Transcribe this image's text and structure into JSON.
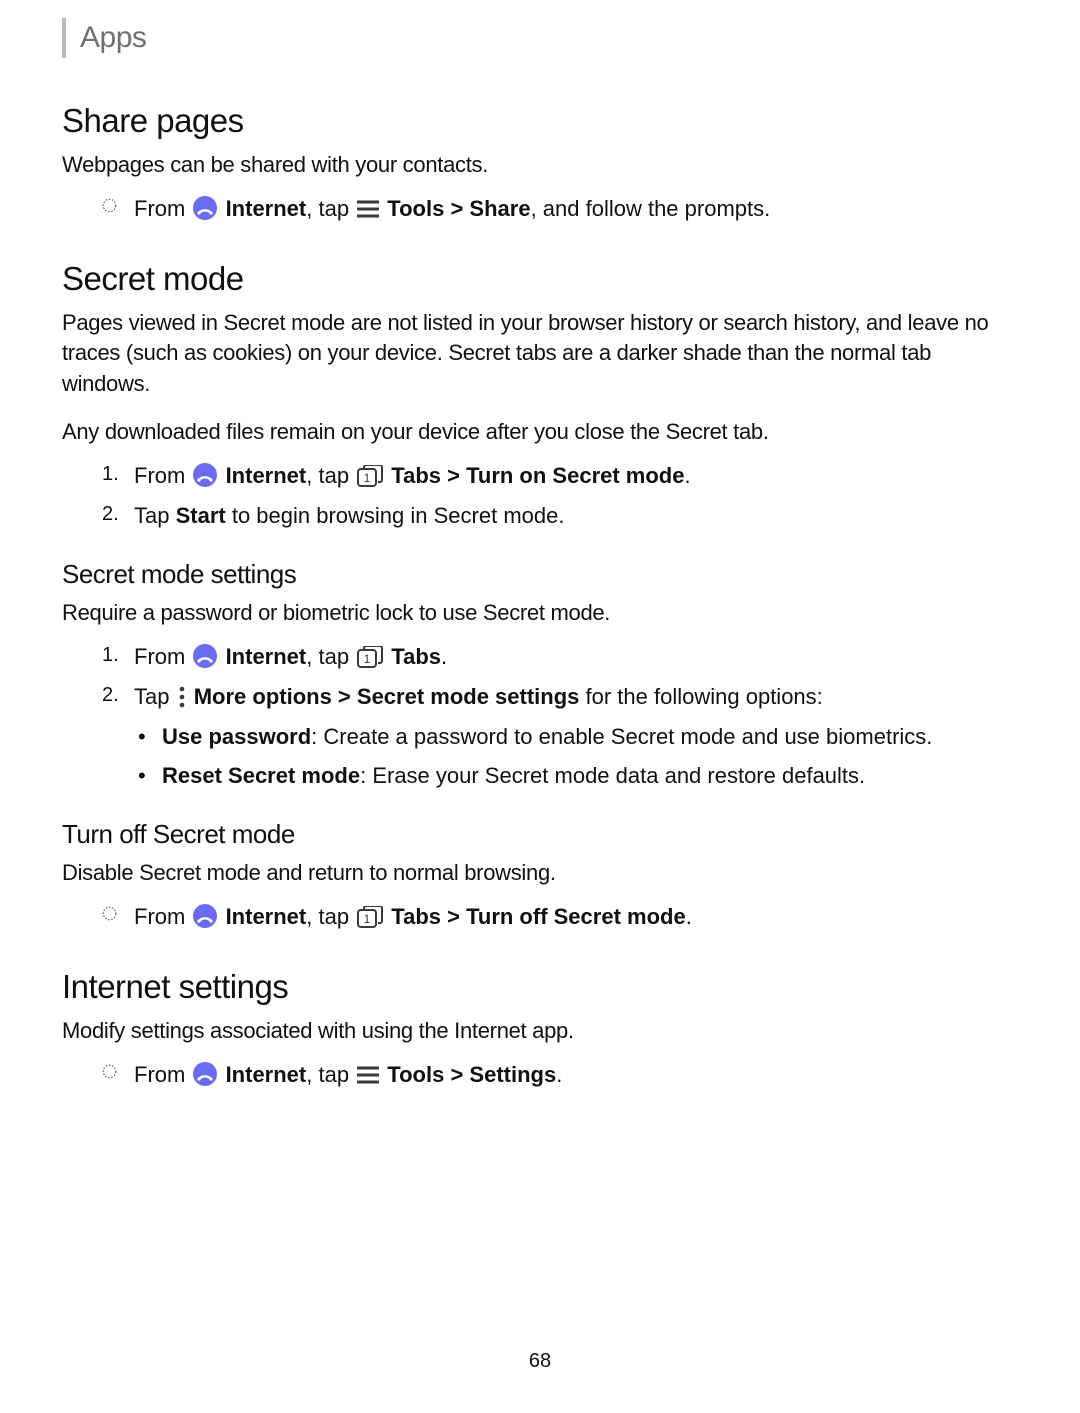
{
  "header": {
    "label": "Apps"
  },
  "sections": {
    "share": {
      "title": "Share pages",
      "desc": "Webpages can be shared with your contacts.",
      "step_prefix": "From ",
      "internet": " Internet",
      "step_mid1": ", tap ",
      "tools": " Tools",
      "sep": " > ",
      "share": "Share",
      "step_suffix": ", and follow the prompts."
    },
    "secret": {
      "title": "Secret mode",
      "desc1": "Pages viewed in Secret mode are not listed in your browser history or search history, and leave no traces (such as cookies) on your device. Secret tabs are a darker shade than the normal tab windows.",
      "desc2": "Any downloaded files remain on your device after you close the Secret tab.",
      "s1_prefix": "From ",
      "s1_internet": " Internet",
      "s1_mid": ", tap ",
      "s1_tabs": " Tabs",
      "s1_sep": " > ",
      "s1_action": "Turn on Secret mode",
      "s1_end": ".",
      "s2_prefix": "Tap ",
      "s2_start": "Start",
      "s2_rest": " to begin browsing in Secret mode."
    },
    "secret_settings": {
      "title": "Secret mode settings",
      "desc": "Require a password or biometric lock to use Secret mode.",
      "s1_prefix": "From ",
      "s1_internet": " Internet",
      "s1_mid": ", tap ",
      "s1_tabs": " Tabs",
      "s1_end": ".",
      "s2_prefix": "Tap ",
      "s2_more": " More options",
      "s2_sep": " > ",
      "s2_sms": "Secret mode settings",
      "s2_rest": " for the following options:",
      "opt1_label": "Use password",
      "opt1_rest": ": Create a password to enable Secret mode and use biometrics.",
      "opt2_label": "Reset Secret mode",
      "opt2_rest": ": Erase your Secret mode data and restore defaults."
    },
    "turnoff": {
      "title": "Turn off Secret mode",
      "desc": "Disable Secret mode and return to normal browsing.",
      "s_prefix": "From ",
      "s_internet": " Internet",
      "s_mid": ", tap ",
      "s_tabs": " Tabs",
      "s_sep": " > ",
      "s_action": "Turn off Secret mode",
      "s_end": "."
    },
    "isettings": {
      "title": "Internet settings",
      "desc": "Modify settings associated with using the Internet app.",
      "s_prefix": "From ",
      "s_internet": " Internet",
      "s_mid": ", tap ",
      "s_tools": " Tools",
      "s_sep": " > ",
      "s_action": "Settings",
      "s_end": "."
    }
  },
  "markers": {
    "n1": "1.",
    "n2": "2."
  },
  "page_number": "68"
}
